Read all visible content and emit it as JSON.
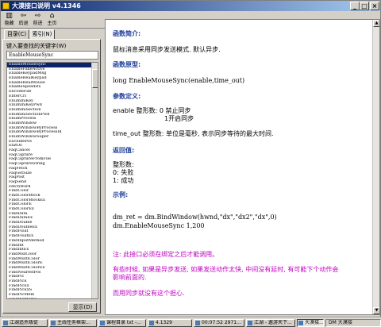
{
  "window": {
    "title": "大漠接口说明 v4.1346"
  },
  "toolbar": {
    "hide_label": "隐藏",
    "back_label": "后退",
    "forward_label": "前进",
    "home_label": "主页"
  },
  "left_pane": {
    "tabs": [
      {
        "label": "目录(C)"
      },
      {
        "label": "索引(N)"
      }
    ],
    "search_label": "键入要查找的关键字(W)",
    "search_value": "EnableMouseSync",
    "display_button": "显示(D)",
    "index_items": [
      "EnableMouseSync",
      "EnableFakeActive",
      "EnableKeypadMsg",
      "EnableRealKeypad",
      "EnableRealMouse",
      "EnableSpeedDx",
      "EncodeFile",
      "EnterCri",
      "EnumIniKey",
      "EnumIniKeyPwd",
      "EnumIniSection",
      "EnumIniSectionPwd",
      "EnumProcess",
      "EnumWindow",
      "EnumWindowByProcess",
      "EnumWindowByProcessId",
      "EnumWindowSuper",
      "ExcludePos",
      "ExitOs",
      "FaqCancel",
      "FaqCapture",
      "FaqCaptureFromFile",
      "FaqCaptureString",
      "FaqFetch",
      "FaqGetSize",
      "FaqPost",
      "FaqSend",
      "FetchWord",
      "FindColor",
      "FindColorBlock",
      "FindColorBlockEx",
      "FindColorE",
      "FindColorEx",
      "FindData",
      "FindDataEx",
      "FindDouble",
      "FindDoubleEx",
      "FindFloat",
      "FindFloatEx",
      "FindInputMethod",
      "FindInt",
      "FindIntEx",
      "FindMulColor",
      "FindMultiColor",
      "FindMultiColorE",
      "FindMultiColorEx",
      "FindNearestPos",
      "FindPic",
      "FindPicE",
      "FindPicEx",
      "FindPicExS",
      "FindPicMem",
      "FindPicMemE",
      "FindPicMemEx",
      "FindPicS"
    ]
  },
  "content": {
    "h_intro": "函数简介:",
    "intro_text": "鼠标消息采用同步发送模式. 默认异步.",
    "h_prototype": "函数原型:",
    "prototype": "long EnableMouseSync(enable,time_out)",
    "h_params": "参数定义:",
    "param_enable": "enable 整形数: 0 禁止同步",
    "param_enable_2": "1开启同步",
    "param_timeout": "time_out 整形数: 单位是毫秒, 表示同步等待的最大时间.",
    "h_return": "返回值:",
    "return_type": "整形数:",
    "return_0": "0: 失败",
    "return_1": "1: 成功",
    "h_example": "示例:",
    "example_1": "dm_ret = dm.BindWindow(hwnd,\"dx\",\"dx2\",\"dx\",0)",
    "example_2": "dm.EnableMouseSync 1,200",
    "note_1": "注: 此接口必须在绑定之后才能调用。",
    "note_2a": "有些时候, 如果是异步发送, 如果发送动作太快, 中间没有延时, 有可能下个动作会",
    "note_2b": "影响前面的.",
    "note_3": "而用同步就没有这个担心."
  },
  "taskbar": {
    "items": [
      {
        "label": "江湖追杀叛徒"
      },
      {
        "label": "主线任务框架..."
      },
      {
        "label": "课程目录 txt -..."
      },
      {
        "label": "4.1329"
      },
      {
        "label": "00:07:52 2971..."
      },
      {
        "label": "江湖 - 遨游天下..."
      },
      {
        "label": "大漠接..."
      }
    ],
    "tray_text": "DM 大漠接"
  }
}
